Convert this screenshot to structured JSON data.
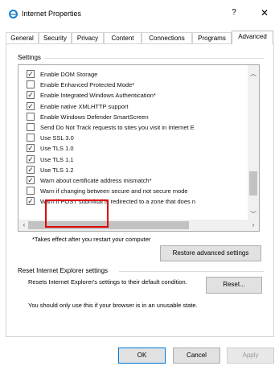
{
  "window": {
    "title": "Internet Properties",
    "help": "?",
    "close": "✕"
  },
  "tabs": [
    "General",
    "Security",
    "Privacy",
    "Content",
    "Connections",
    "Programs",
    "Advanced"
  ],
  "settings": {
    "group_label": "Settings",
    "items": [
      {
        "label": "Enable DOM Storage",
        "checked": true
      },
      {
        "label": "Enable Enhanced Protected Mode*",
        "checked": false
      },
      {
        "label": "Enable Integrated Windows Authentication*",
        "checked": true
      },
      {
        "label": "Enable native XMLHTTP support",
        "checked": true
      },
      {
        "label": "Enable Windows Defender SmartScreen",
        "checked": false
      },
      {
        "label": "Send Do Not Track requests to sites you visit in Internet E",
        "checked": false
      },
      {
        "label": "Use SSL 3.0",
        "checked": false
      },
      {
        "label": "Use TLS 1.0",
        "checked": true
      },
      {
        "label": "Use TLS 1.1",
        "checked": true
      },
      {
        "label": "Use TLS 1.2",
        "checked": true
      },
      {
        "label": "Warn about certificate address mismatch*",
        "checked": true
      },
      {
        "label": "Warn if changing between secure and not secure mode",
        "checked": false
      },
      {
        "label": "Warn if POST submittal is redirected to a zone that does n",
        "checked": true
      }
    ],
    "restart_note": "*Takes effect after you restart your computer",
    "restore_button": "Restore advanced settings"
  },
  "reset": {
    "group_label": "Reset Internet Explorer settings",
    "description": "Resets Internet Explorer's settings to their default condition.",
    "button": "Reset...",
    "warning": "You should only use this if your browser is in an unusable state."
  },
  "footer": {
    "ok": "OK",
    "cancel": "Cancel",
    "apply": "Apply"
  },
  "colors": {
    "highlight": "#e00000",
    "focus": "#0078d7"
  }
}
